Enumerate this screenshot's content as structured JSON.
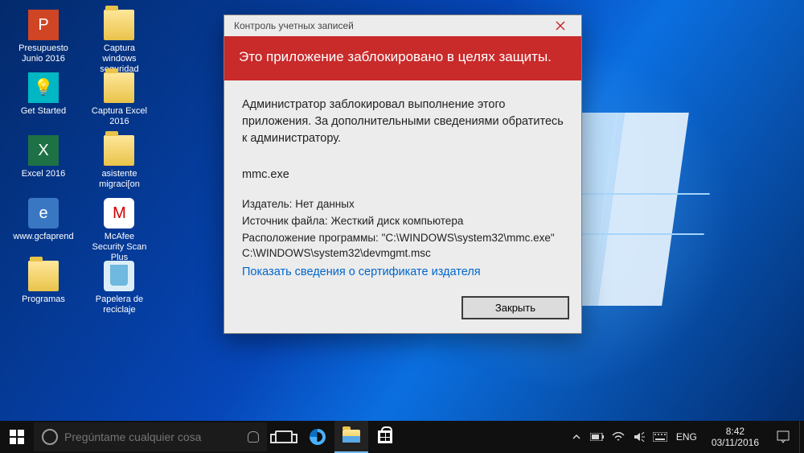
{
  "desktop_icons": {
    "col1": [
      {
        "label": "Presupuesto Junio 2016",
        "glyph": "P",
        "cls": "pp"
      },
      {
        "label": "Get Started",
        "glyph": "💡",
        "cls": "bulb"
      },
      {
        "label": "Excel 2016",
        "glyph": "X",
        "cls": "excel"
      },
      {
        "label": "www.gcfaprend",
        "glyph": "e",
        "cls": "ie"
      },
      {
        "label": "Programas",
        "glyph": "",
        "cls": "folder"
      }
    ],
    "col2": [
      {
        "label": "Captura windows seguridad",
        "glyph": "",
        "cls": "folder"
      },
      {
        "label": "Captura Excel 2016",
        "glyph": "",
        "cls": "folder"
      },
      {
        "label": "asistente migraci[on",
        "glyph": "",
        "cls": "folder"
      },
      {
        "label": "McAfee Security Scan Plus",
        "glyph": "M",
        "cls": "mcafee"
      },
      {
        "label": "Papelera de reciclaje",
        "glyph": "",
        "cls": "bin"
      }
    ]
  },
  "uac": {
    "title": "Контроль учетных записей",
    "banner": "Это приложение заблокировано в целях защиты.",
    "message": "Администратор заблокировал выполнение этого приложения. За дополнительными сведениями обратитесь к администратору.",
    "program": "mmc.exe",
    "publisher_label": "Издатель:",
    "publisher_value": "Нет данных",
    "origin_label": "Источник файла:",
    "origin_value": "Жесткий диск компьютера",
    "location_label": "Расположение программы:",
    "location_value": "\"C:\\WINDOWS\\system32\\mmc.exe\" C:\\WINDOWS\\system32\\devmgmt.msc",
    "cert_link": "Показать сведения о сертификате издателя",
    "close_button": "Закрыть"
  },
  "taskbar": {
    "search_placeholder": "Pregúntame cualquier cosa",
    "language": "ENG",
    "time": "8:42",
    "date": "03/11/2016"
  }
}
